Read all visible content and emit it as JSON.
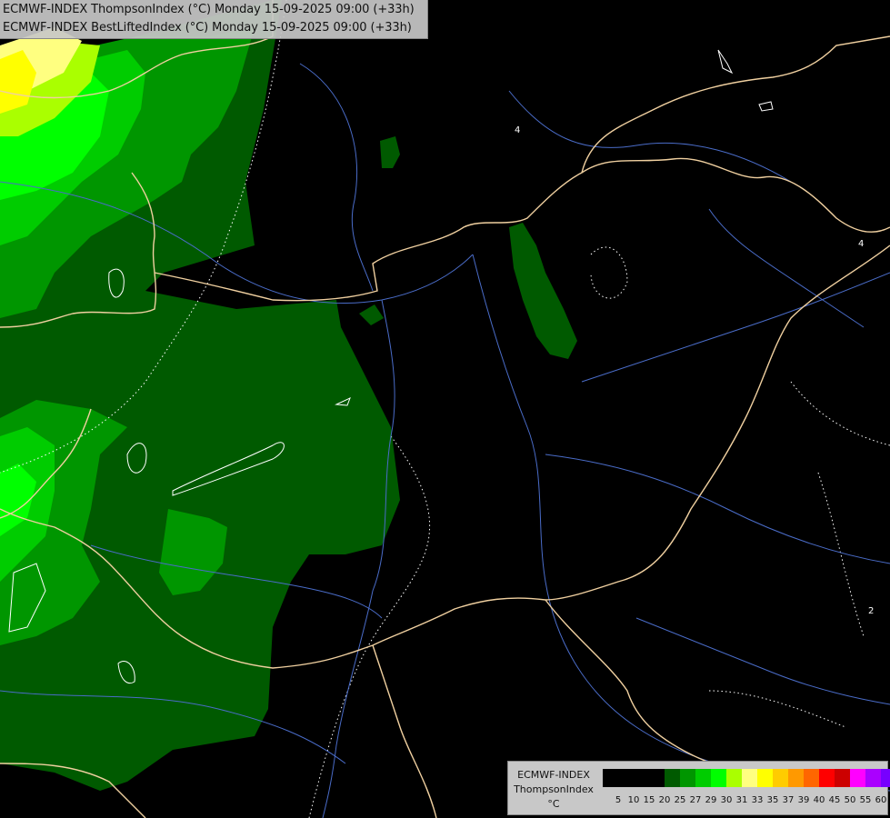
{
  "title": {
    "line1": "ECMWF-INDEX ThompsonIndex (°C) Monday 15-09-2025 09:00 (+33h)",
    "line2": "ECMWF-INDEX BestLiftedIndex (°C) Monday 15-09-2025 09:00 (+33h)"
  },
  "legend": {
    "title_line1": "ECMWF-INDEX",
    "title_line2": "ThompsonIndex",
    "unit": "°C",
    "tick_labels": [
      "5",
      "10",
      "15",
      "20",
      "25",
      "27",
      "29",
      "30",
      "31",
      "33",
      "35",
      "37",
      "39",
      "40",
      "45",
      "50",
      "55",
      "60"
    ],
    "swatch_colors": [
      "#000000",
      "#000000",
      "#000000",
      "#000000",
      "#005a00",
      "#009600",
      "#00cc00",
      "#00ff00",
      "#aaff00",
      "#ffff80",
      "#ffff00",
      "#ffcc00",
      "#ff9900",
      "#ff6600",
      "#ff0000",
      "#cc0000",
      "#ff00ff",
      "#aa00ff",
      "#7700ff",
      "#0000ff"
    ]
  },
  "contour_labels": [
    "4",
    "4",
    "2"
  ],
  "colors": {
    "background": "#000000",
    "borders": "#f0d0a0",
    "rivers": "#4a6cc8",
    "contours": "#ffffff"
  }
}
